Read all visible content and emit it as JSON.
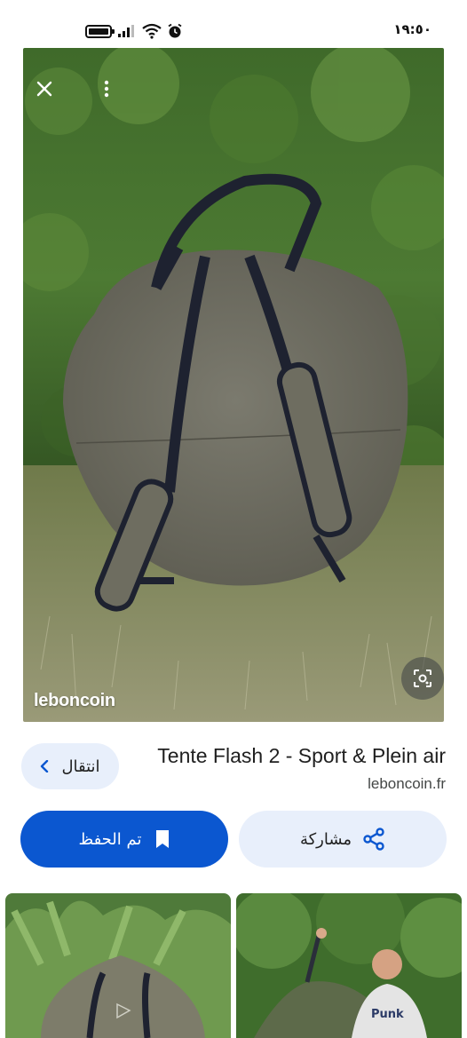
{
  "status_bar": {
    "time": "١٩:٥٠",
    "icons": [
      "battery-icon",
      "signal-icon",
      "wifi-icon",
      "alarm-icon"
    ]
  },
  "image": {
    "watermark": "leboncoin",
    "close_icon": "close-icon",
    "menu_icon": "more-vert-icon",
    "lens_icon": "lens-icon"
  },
  "result": {
    "title": "Tente Flash 2 - Sport & Plein air",
    "source": "leboncoin.fr",
    "visit_label": "انتقال"
  },
  "actions": {
    "saved_label": "تم الحفظ",
    "share_label": "مشاركة"
  },
  "related": {
    "thumbnails": [
      {
        "caption": "",
        "jersey_text": ""
      },
      {
        "caption": "",
        "jersey_text": "Punk"
      }
    ]
  },
  "colors": {
    "primary": "#0b57d0",
    "tonal": "#e8effb",
    "text": "#1f1f1f",
    "secondary_text": "#444746"
  }
}
